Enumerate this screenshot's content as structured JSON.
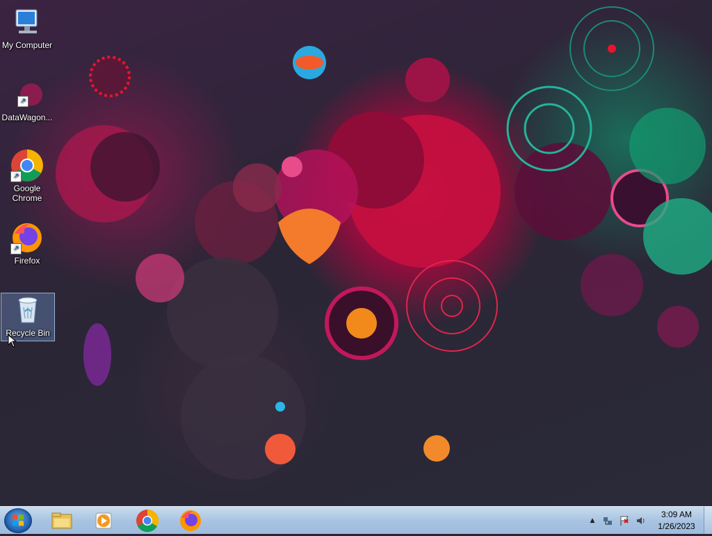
{
  "desktop": {
    "icons": [
      {
        "label": "My Computer"
      },
      {
        "label": "DataWagon..."
      },
      {
        "label": "Google Chrome"
      },
      {
        "label": "Firefox"
      },
      {
        "label": "Recycle Bin"
      }
    ]
  },
  "taskbar": {
    "pinned": [
      {
        "name": "windows-explorer"
      },
      {
        "name": "windows-media-player"
      },
      {
        "name": "google-chrome"
      },
      {
        "name": "firefox"
      }
    ],
    "tray": {
      "show_hidden_glyph": "▲",
      "time": "3:09 AM",
      "date": "1/26/2023"
    }
  },
  "colors": {
    "taskbar_top": "#c9dcef",
    "taskbar_bottom": "#9dbbdd",
    "wallpaper_base": "#2b2636",
    "accent_magenta": "#d4145a",
    "accent_teal": "#1b6b5a"
  }
}
